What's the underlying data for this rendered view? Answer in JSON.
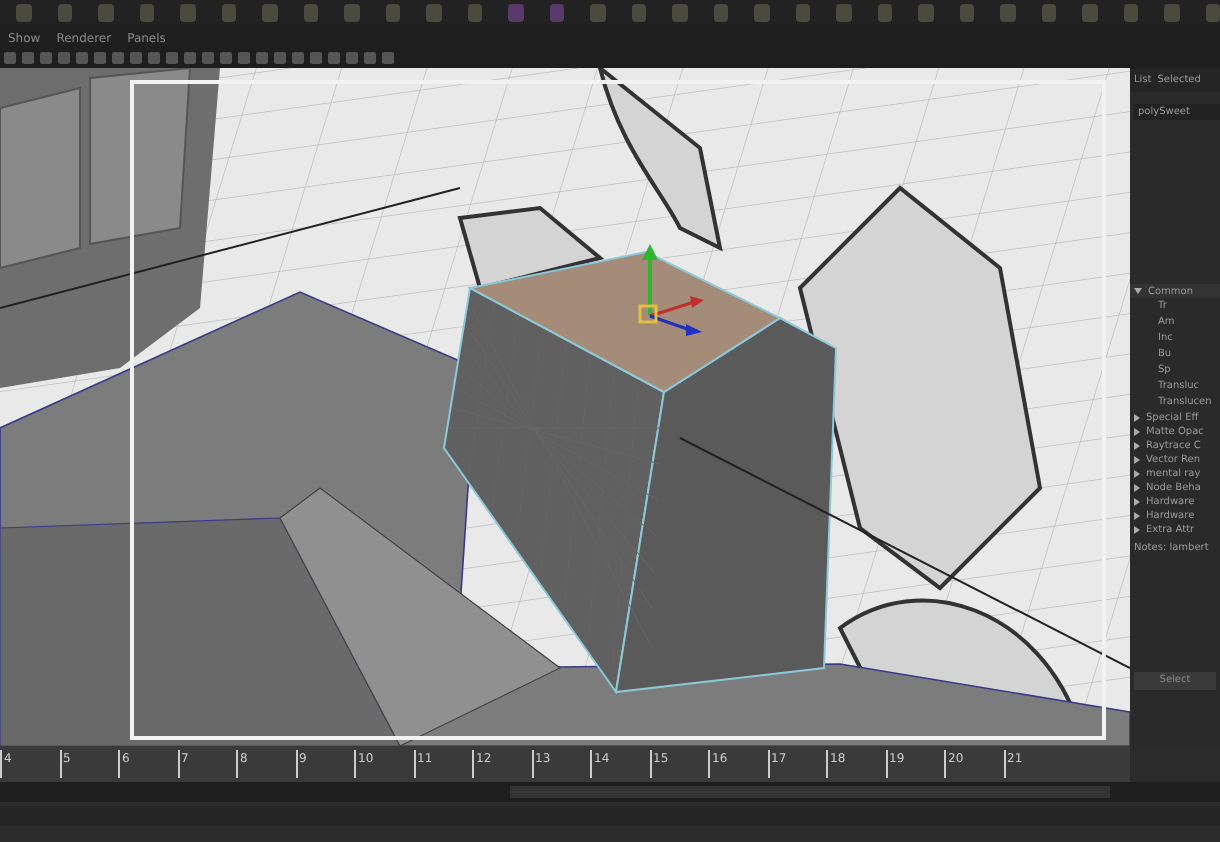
{
  "panel_menu": [
    "Show",
    "Renderer",
    "Panels"
  ],
  "attribute_editor": {
    "tabs": [
      {
        "label": "List",
        "selected": false
      },
      {
        "label": "Selected",
        "selected": false
      }
    ],
    "node": "polySweet",
    "sections_top": [
      {
        "label": "Common",
        "expanded": true
      }
    ],
    "attributes": [
      "Tr",
      "Am",
      "Inc",
      "Bu",
      "Sp",
      "Transluc",
      "Translucen"
    ],
    "sections": [
      {
        "label": "Special Eff",
        "expanded": false
      },
      {
        "label": "Matte Opac",
        "expanded": false
      },
      {
        "label": "Raytrace C",
        "expanded": false
      },
      {
        "label": "Vector Ren",
        "expanded": false
      },
      {
        "label": "mental ray",
        "expanded": false
      },
      {
        "label": "Node Beha",
        "expanded": false
      },
      {
        "label": "Hardware",
        "expanded": false
      },
      {
        "label": "Hardware",
        "expanded": false
      },
      {
        "label": "Extra Attr",
        "expanded": false
      }
    ],
    "notes": "Notes: lambert",
    "button": "Select"
  },
  "timeline": {
    "ticks": [
      "4",
      "5",
      "6",
      "7",
      "8",
      "9",
      "10",
      "11",
      "12",
      "13",
      "14",
      "15",
      "16",
      "17",
      "18",
      "19",
      "20",
      "21"
    ]
  }
}
